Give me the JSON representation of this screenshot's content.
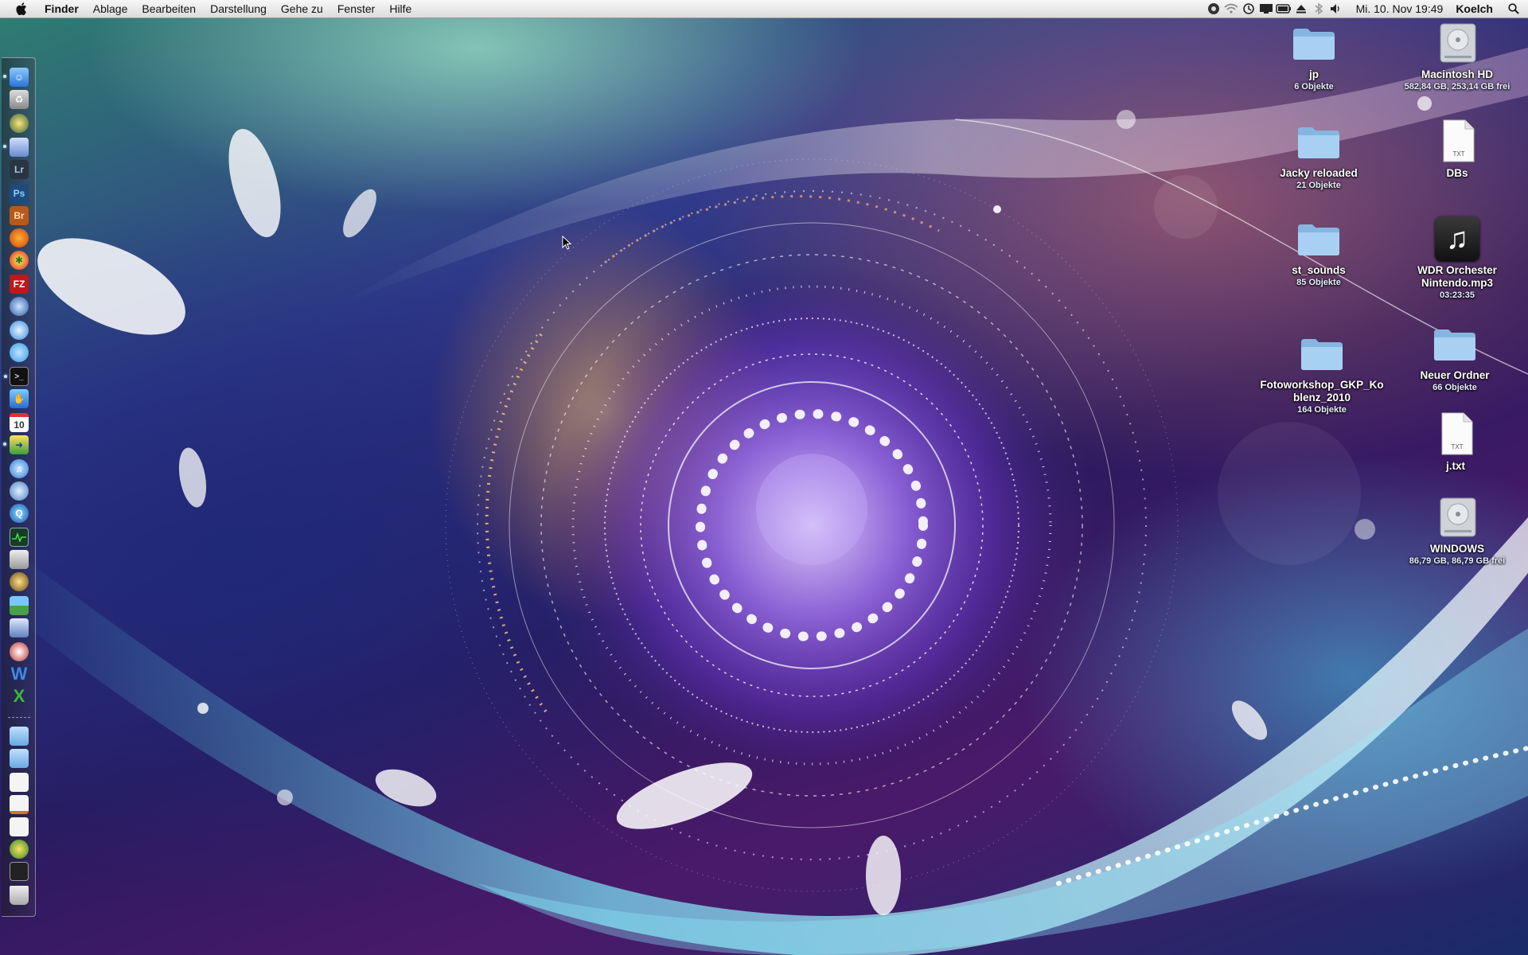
{
  "menubar": {
    "apple_icon": "apple-icon",
    "app_name": "Finder",
    "menus": [
      "Ablage",
      "Bearbeiten",
      "Darstellung",
      "Gehe zu",
      "Fenster",
      "Hilfe"
    ],
    "status_icons": [
      "sync-icon",
      "wifi-icon",
      "time-machine-icon",
      "display-icon",
      "battery-icon",
      "eject-icon",
      "bluetooth-icon",
      "volume-icon"
    ],
    "clock": "Mi. 10. Nov  19:49",
    "user": "Koelch",
    "spotlight_icon": "spotlight-icon"
  },
  "dock": {
    "items": [
      {
        "name": "finder",
        "icon": "finder-icon"
      },
      {
        "name": "recycle",
        "icon": "trash-recycle-icon"
      },
      {
        "name": "dvd-player",
        "icon": "film-reel-icon"
      },
      {
        "name": "preview",
        "icon": "preview-icon"
      },
      {
        "name": "lightroom",
        "label": "Lr",
        "icon": "lightroom-icon"
      },
      {
        "name": "photoshop",
        "label": "Ps",
        "icon": "photoshop-icon"
      },
      {
        "name": "bridge",
        "label": "Br",
        "icon": "bridge-icon"
      },
      {
        "name": "firefox",
        "icon": "firefox-icon"
      },
      {
        "name": "crossover",
        "icon": "crossover-icon"
      },
      {
        "name": "filezilla",
        "label": "FZ",
        "icon": "filezilla-icon"
      },
      {
        "name": "network",
        "icon": "globe-icon"
      },
      {
        "name": "safari",
        "icon": "safari-icon"
      },
      {
        "name": "ichat",
        "icon": "chat-icon"
      },
      {
        "name": "terminal",
        "icon": "terminal-icon"
      },
      {
        "name": "cyberduck",
        "icon": "hand-icon"
      },
      {
        "name": "ical",
        "label": "10",
        "icon": "calendar-icon"
      },
      {
        "name": "sequel",
        "icon": "arrow-icon"
      },
      {
        "name": "itunes",
        "icon": "itunes-icon"
      },
      {
        "name": "spotlight-app",
        "icon": "search-app-icon"
      },
      {
        "name": "quicktime",
        "icon": "quicktime-icon"
      },
      {
        "name": "activity-monitor",
        "icon": "activity-monitor-icon"
      },
      {
        "name": "grab",
        "icon": "grab-icon"
      },
      {
        "name": "aperture",
        "icon": "aperture-icon"
      },
      {
        "name": "photo-app",
        "icon": "landscape-icon"
      },
      {
        "name": "automator",
        "icon": "automator-icon"
      },
      {
        "name": "clock",
        "icon": "clock-icon"
      },
      {
        "name": "word",
        "label": "W",
        "icon": "word-icon"
      },
      {
        "name": "excel",
        "label": "X",
        "icon": "excel-icon"
      }
    ],
    "stacks": [
      {
        "name": "folder-1",
        "icon": "folder-icon"
      },
      {
        "name": "folder-2",
        "icon": "folder-icon"
      },
      {
        "name": "doc-1",
        "icon": "document-icon"
      },
      {
        "name": "doc-2",
        "icon": "document-icon"
      },
      {
        "name": "doc-3",
        "icon": "document-icon"
      },
      {
        "name": "download",
        "icon": "download-icon"
      },
      {
        "name": "doc-4",
        "icon": "document-icon"
      },
      {
        "name": "trash",
        "icon": "trash-icon"
      }
    ]
  },
  "desktop": {
    "icons": [
      {
        "id": "jp",
        "type": "folder",
        "name": "jp",
        "info": "6 Objekte"
      },
      {
        "id": "macintosh-hd",
        "type": "drive",
        "name": "Macintosh HD",
        "info": "582,84 GB, 253,14 GB frei"
      },
      {
        "id": "jacky",
        "type": "folder",
        "name": "Jacky reloaded",
        "info": "21 Objekte"
      },
      {
        "id": "dbs",
        "type": "txt",
        "name": "DBs",
        "info": ""
      },
      {
        "id": "st-sounds",
        "type": "folder",
        "name": "st_sounds",
        "info": "85 Objekte"
      },
      {
        "id": "wdr",
        "type": "mp3",
        "name": "WDR Orchester Nintendo.mp3",
        "info": "03:23:35"
      },
      {
        "id": "fotoworkshop",
        "type": "folder",
        "name": "Fotoworkshop_GKP_Koblenz_2010",
        "name_line1": "Fotoworkshop_GKP_Ko",
        "name_line2": "blenz_2010",
        "info": "164 Objekte"
      },
      {
        "id": "neuer-ordner",
        "type": "folder",
        "name": "Neuer Ordner",
        "info": "66 Objekte"
      },
      {
        "id": "j-txt",
        "type": "txt",
        "name": "j.txt",
        "info": ""
      },
      {
        "id": "windows",
        "type": "drive",
        "name": "WINDOWS",
        "info": "86,79 GB, 86,79 GB frei"
      }
    ],
    "txt_badge": "TXT"
  },
  "colors": {
    "folder_blue": "#9cc6ea",
    "menubar_bg": "#e9e9e9"
  }
}
